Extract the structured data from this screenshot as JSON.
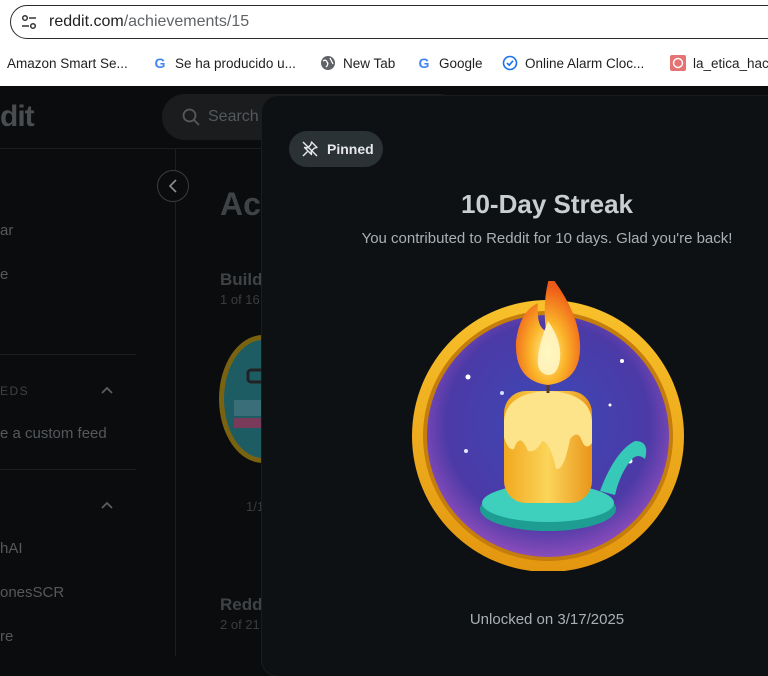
{
  "browser": {
    "url_domain": "reddit.com",
    "url_path": "/achievements/15",
    "bookmarks": [
      {
        "label": "Amazon Smart Se...",
        "icon": "none"
      },
      {
        "label": "Se ha producido u...",
        "icon": "google-icon"
      },
      {
        "label": "New Tab",
        "icon": "globe-icon"
      },
      {
        "label": "Google",
        "icon": "google-icon"
      },
      {
        "label": "Online Alarm Cloc...",
        "icon": "alarm-check-icon"
      },
      {
        "label": "la_etica_hac",
        "icon": "site-icon"
      }
    ]
  },
  "reddit": {
    "logo": "dit",
    "search_placeholder": "Search",
    "sidebar": {
      "items_top": [
        "ar",
        "e"
      ],
      "section_feeds": "EDS",
      "create_feed": "e a custom feed",
      "communities": [
        "hAI",
        "onesSCR",
        "re"
      ]
    },
    "page_title": "Ac",
    "section1": {
      "title": "Build",
      "count": "1 of 16"
    },
    "section1_fraction": "1/1",
    "section2": {
      "title": "Redd",
      "count": "2 of 21"
    }
  },
  "modal": {
    "pinned_label": "Pinned",
    "title": "10-Day Streak",
    "description": "You contributed to Reddit for 10 days. Glad you're back!",
    "unlocked": "Unlocked on 3/17/2025"
  },
  "colors": {
    "badge_ring": "#f3b21b",
    "badge_inner": "#4a3aa8",
    "candle": "#f6c23b",
    "flame": "#f26a1b",
    "holder": "#36c9b8"
  }
}
